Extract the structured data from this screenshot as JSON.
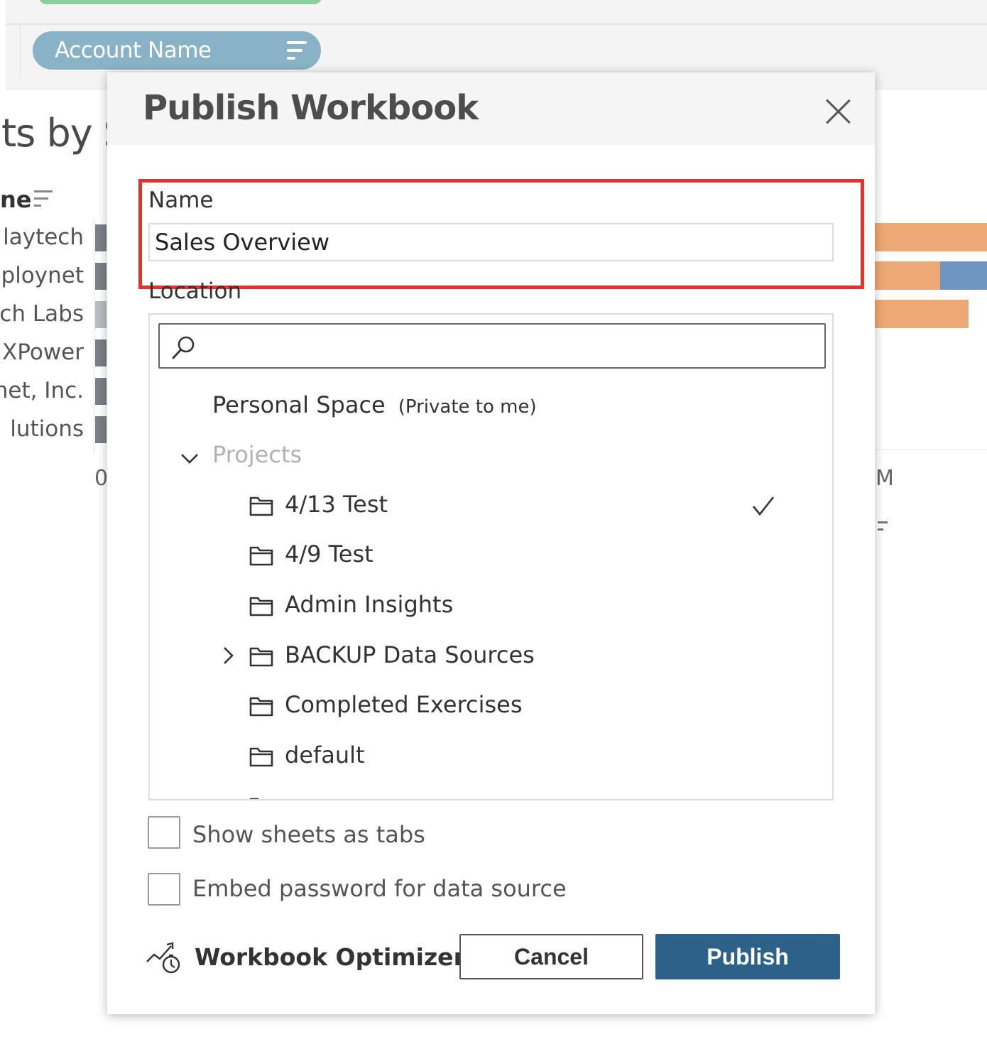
{
  "background": {
    "filter_pill": "Account Name",
    "sheet_title": "ts by S",
    "column_header": "ne",
    "rows": [
      "laytech",
      "ploynet",
      "ch Labs",
      "XPower",
      "net, Inc.",
      "lutions"
    ],
    "axis_start": "0",
    "axis_end": "M"
  },
  "dialog": {
    "title": "Publish Workbook",
    "name_label": "Name",
    "name_value": "Sales Overview",
    "location_label": "Location",
    "search_placeholder": "",
    "personal_space": "Personal Space",
    "personal_space_note": "(Private to me)",
    "projects_label": "Projects",
    "projects": [
      {
        "label": "4/13 Test",
        "selected": true
      },
      {
        "label": "4/9 Test"
      },
      {
        "label": "Admin Insights"
      },
      {
        "label": "BACKUP Data Sources",
        "expandable": true
      },
      {
        "label": "Completed Exercises"
      },
      {
        "label": "default"
      }
    ],
    "show_sheets_as_tabs": "Show sheets as tabs",
    "embed_password": "Embed password for data source",
    "optimizer": "Workbook Optimizer",
    "cancel": "Cancel",
    "publish": "Publish"
  },
  "colors": {
    "publish_button": "#2d6189",
    "highlight": "#e3342a",
    "pill": "#89b2c6",
    "bar_orange": "#eea873",
    "bar_blue": "#6f96c1"
  }
}
